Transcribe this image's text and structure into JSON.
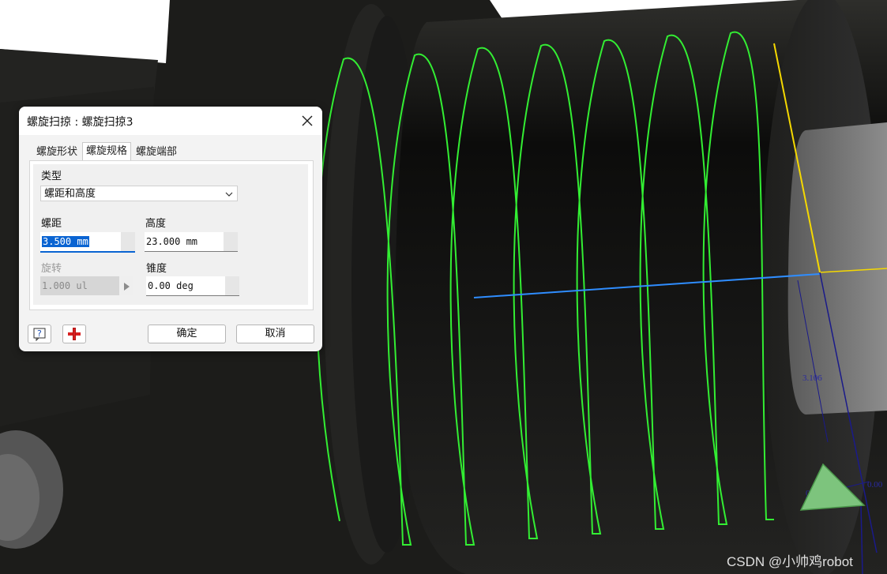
{
  "viewport": {
    "dimension_label": "3.106",
    "angle_label_1": "0.00",
    "angle_label_2": "0.00",
    "colors": {
      "background": "#1c1c1a",
      "helix": "#33ee33",
      "axis": "#2f8dff",
      "yellow_edge": "#f5d800",
      "navy_dim": "#1a1a8a"
    }
  },
  "dialog": {
    "title": "螺旋扫掠 : 螺旋扫掠3",
    "close_icon": "close-icon",
    "tabs": [
      {
        "label": "螺旋形状",
        "active": false
      },
      {
        "label": "螺旋规格",
        "active": true
      },
      {
        "label": "螺旋端部",
        "active": false
      }
    ],
    "type_label": "类型",
    "type_value": "螺距和高度",
    "pitch_label": "螺距",
    "pitch_value": "3.500 mm",
    "height_label": "高度",
    "height_value": "23.000 mm",
    "rotation_label": "旋转",
    "rotation_value": "1.000 ul",
    "taper_label": "锥度",
    "taper_value": "0.00 deg",
    "help_icon": "help-icon",
    "add_icon": "plus-icon",
    "ok_label": "确定",
    "cancel_label": "取消"
  },
  "watermark": "CSDN @小帅鸡robot"
}
